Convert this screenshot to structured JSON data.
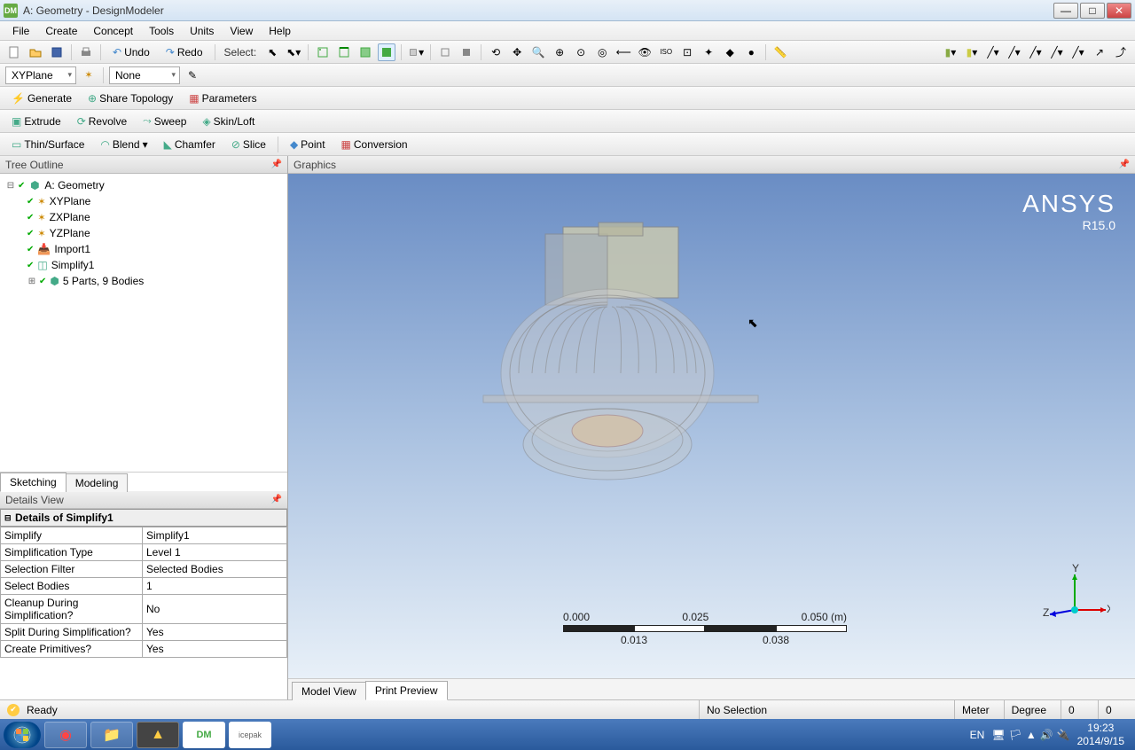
{
  "window": {
    "title": "A: Geometry - DesignModeler"
  },
  "menubar": [
    "File",
    "Create",
    "Concept",
    "Tools",
    "Units",
    "View",
    "Help"
  ],
  "toolbar1": {
    "undo": "Undo",
    "redo": "Redo",
    "select_label": "Select:"
  },
  "toolbar2": {
    "plane_dropdown": "XYPlane",
    "sketch_dropdown": "None"
  },
  "toolbar3": {
    "generate": "Generate",
    "share_topology": "Share Topology",
    "parameters": "Parameters"
  },
  "toolbar4": {
    "extrude": "Extrude",
    "revolve": "Revolve",
    "sweep": "Sweep",
    "skin_loft": "Skin/Loft"
  },
  "toolbar5": {
    "thin_surface": "Thin/Surface",
    "blend": "Blend",
    "chamfer": "Chamfer",
    "slice": "Slice",
    "point": "Point",
    "conversion": "Conversion"
  },
  "tree": {
    "header": "Tree Outline",
    "root": "A: Geometry",
    "nodes": [
      {
        "label": "XYPlane"
      },
      {
        "label": "ZXPlane"
      },
      {
        "label": "YZPlane"
      },
      {
        "label": "Import1"
      },
      {
        "label": "Simplify1"
      },
      {
        "label": "5 Parts, 9 Bodies"
      }
    ]
  },
  "tree_tabs": {
    "sketching": "Sketching",
    "modeling": "Modeling"
  },
  "details": {
    "header": "Details View",
    "title": "Details of Simplify1",
    "rows": [
      {
        "k": "Simplify",
        "v": "Simplify1"
      },
      {
        "k": "Simplification Type",
        "v": "Level 1"
      },
      {
        "k": "Selection Filter",
        "v": "Selected Bodies"
      },
      {
        "k": "Select Bodies",
        "v": "1"
      },
      {
        "k": "Cleanup During Simplification?",
        "v": "No"
      },
      {
        "k": "Split During Simplification?",
        "v": "Yes"
      },
      {
        "k": "Create Primitives?",
        "v": "Yes"
      }
    ]
  },
  "graphics": {
    "header": "Graphics",
    "logo": "ANSYS",
    "version": "R15.0",
    "scale": {
      "ticks": [
        "0.000",
        "0.025",
        "0.050 (m)"
      ],
      "sub": [
        "0.013",
        "0.038"
      ]
    },
    "triad": {
      "x": "X",
      "y": "Y",
      "z": "Z"
    },
    "view_tabs": {
      "model": "Model View",
      "print": "Print Preview"
    }
  },
  "status": {
    "ready": "Ready",
    "selection": "No Selection",
    "unit1": "Meter",
    "unit2": "Degree",
    "coord1": "0",
    "coord2": "0"
  },
  "taskbar": {
    "lang": "EN",
    "time": "19:23",
    "date": "2014/9/15"
  }
}
